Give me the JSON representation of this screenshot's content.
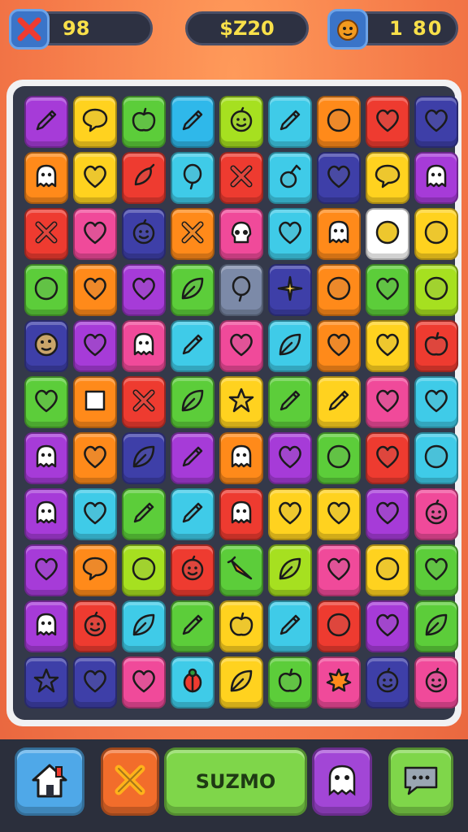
{
  "hud": {
    "lives_value": "98",
    "score_value": "$Z20",
    "coins_value": "1 80"
  },
  "bottom": {
    "play_label": "SUZMO"
  },
  "colors": {
    "purple": "#a63bd8",
    "yellow": "#ffd21f",
    "green": "#5ccd3a",
    "blue": "#2fb8ea",
    "lime": "#a6e020",
    "cyan": "#3fcbe8",
    "orange": "#ff8a1a",
    "red": "#ee3b30",
    "navy": "#3e3fa8",
    "pink": "#f04a9a",
    "gray": "#7c8aa8",
    "white": "#ffffff"
  },
  "board": [
    [
      [
        "purple",
        "pencil-icon"
      ],
      [
        "yellow",
        "speech-bubble-icon"
      ],
      [
        "green",
        "apple-icon"
      ],
      [
        "blue",
        "pencil-icon"
      ],
      [
        "lime",
        "smiley-fruit-icon"
      ],
      [
        "cyan",
        "pencil-icon"
      ],
      [
        "orange",
        "blob-icon"
      ],
      [
        "red",
        "heart-icon"
      ],
      [
        "navy",
        "heart-icon"
      ]
    ],
    [
      [
        "orange",
        "ghost-icon"
      ],
      [
        "yellow",
        "heart-icon"
      ],
      [
        "red",
        "pepper-icon"
      ],
      [
        "cyan",
        "balloon-icon"
      ],
      [
        "red",
        "cross-icon"
      ],
      [
        "cyan",
        "cherry-icon"
      ],
      [
        "navy",
        "heart-icon"
      ],
      [
        "yellow",
        "speech-bubble-icon"
      ],
      [
        "purple",
        "ghost-icon"
      ]
    ],
    [
      [
        "red",
        "cross-icon"
      ],
      [
        "pink",
        "heart-icon"
      ],
      [
        "navy",
        "smiley-fruit-icon"
      ],
      [
        "orange",
        "cross-icon"
      ],
      [
        "pink",
        "skull-icon"
      ],
      [
        "cyan",
        "heart-icon"
      ],
      [
        "orange",
        "ghost-icon"
      ],
      [
        "white",
        "blob-icon"
      ],
      [
        "yellow",
        "blob-icon"
      ]
    ],
    [
      [
        "green",
        "blob-icon"
      ],
      [
        "orange",
        "heart-icon"
      ],
      [
        "purple",
        "heart-icon"
      ],
      [
        "green",
        "leaf-icon"
      ],
      [
        "gray",
        "balloon-icon"
      ],
      [
        "navy",
        "star-burst-icon"
      ],
      [
        "orange",
        "blob-icon"
      ],
      [
        "green",
        "heart-icon"
      ],
      [
        "lime",
        "blob-icon"
      ]
    ],
    [
      [
        "navy",
        "cookie-icon"
      ],
      [
        "purple",
        "heart-icon"
      ],
      [
        "pink",
        "ghost-icon"
      ],
      [
        "cyan",
        "pencil-icon"
      ],
      [
        "pink",
        "heart-icon"
      ],
      [
        "cyan",
        "leaf-icon"
      ],
      [
        "orange",
        "heart-icon"
      ],
      [
        "yellow",
        "heart-icon"
      ],
      [
        "red",
        "apple-icon"
      ]
    ],
    [
      [
        "green",
        "heart-icon"
      ],
      [
        "orange",
        "square-icon"
      ],
      [
        "red",
        "cross-icon"
      ],
      [
        "green",
        "leaf-icon"
      ],
      [
        "yellow",
        "star-icon"
      ],
      [
        "green",
        "pencil-icon"
      ],
      [
        "yellow",
        "pencil-icon"
      ],
      [
        "pink",
        "heart-icon"
      ],
      [
        "cyan",
        "heart-icon"
      ]
    ],
    [
      [
        "purple",
        "ghost-icon"
      ],
      [
        "orange",
        "heart-icon"
      ],
      [
        "navy",
        "leaf-icon"
      ],
      [
        "purple",
        "pencil-icon"
      ],
      [
        "orange",
        "ghost-icon"
      ],
      [
        "purple",
        "heart-icon"
      ],
      [
        "green",
        "blob-icon"
      ],
      [
        "red",
        "heart-icon"
      ],
      [
        "cyan",
        "blob-icon"
      ]
    ],
    [
      [
        "purple",
        "ghost-icon"
      ],
      [
        "cyan",
        "heart-icon"
      ],
      [
        "green",
        "pencil-icon"
      ],
      [
        "cyan",
        "pencil-icon"
      ],
      [
        "red",
        "ghost-icon"
      ],
      [
        "yellow",
        "heart-icon"
      ],
      [
        "yellow",
        "heart-icon"
      ],
      [
        "purple",
        "heart-icon"
      ],
      [
        "pink",
        "smiley-fruit-icon"
      ]
    ],
    [
      [
        "purple",
        "heart-icon"
      ],
      [
        "orange",
        "speech-bubble-icon"
      ],
      [
        "lime",
        "blob-icon"
      ],
      [
        "red",
        "smiley-fruit-icon"
      ],
      [
        "green",
        "carrot-icon"
      ],
      [
        "lime",
        "leaf-icon"
      ],
      [
        "pink",
        "heart-icon"
      ],
      [
        "yellow",
        "blob-icon"
      ],
      [
        "green",
        "heart-icon"
      ]
    ],
    [
      [
        "purple",
        "ghost-icon"
      ],
      [
        "red",
        "smiley-fruit-icon"
      ],
      [
        "cyan",
        "leaf-icon"
      ],
      [
        "green",
        "pencil-icon"
      ],
      [
        "yellow",
        "apple-icon"
      ],
      [
        "cyan",
        "pencil-icon"
      ],
      [
        "red",
        "blob-icon"
      ],
      [
        "purple",
        "heart-icon"
      ],
      [
        "green",
        "leaf-icon"
      ]
    ],
    [
      [
        "navy",
        "star-icon"
      ],
      [
        "navy",
        "heart-icon"
      ],
      [
        "pink",
        "heart-icon"
      ],
      [
        "cyan",
        "bug-icon"
      ],
      [
        "yellow",
        "leaf-icon"
      ],
      [
        "green",
        "apple-icon"
      ],
      [
        "pink",
        "maple-leaf-icon"
      ],
      [
        "navy",
        "smiley-fruit-icon"
      ],
      [
        "pink",
        "smiley-fruit-icon"
      ]
    ]
  ]
}
